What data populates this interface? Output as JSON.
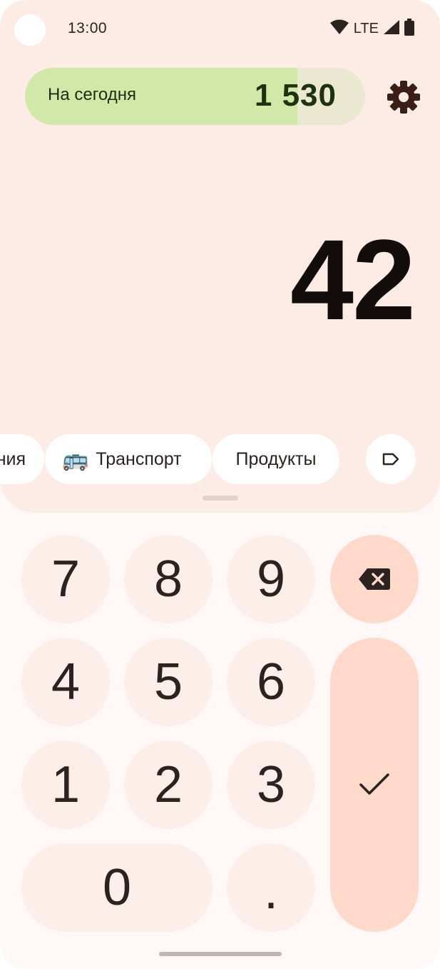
{
  "status_bar": {
    "time": "13:00",
    "network": "LTE"
  },
  "budget": {
    "label": "На сегодня",
    "value": "1 530",
    "spent_fraction": 0.8
  },
  "amount": "42",
  "categories": [
    {
      "label": "ния"
    },
    {
      "label": "Транспорт",
      "emoji": "🚌"
    },
    {
      "label": "Продукты"
    }
  ],
  "keypad": {
    "keys": [
      "7",
      "8",
      "9",
      "4",
      "5",
      "6",
      "1",
      "2",
      "3",
      "0",
      "."
    ],
    "backspace_icon": "backspace-icon",
    "confirm_icon": "check-icon"
  },
  "colors": {
    "accent_fill": "#d2e8a8",
    "confirm_key": "#ffdacb",
    "sheet": "#fcece5"
  }
}
